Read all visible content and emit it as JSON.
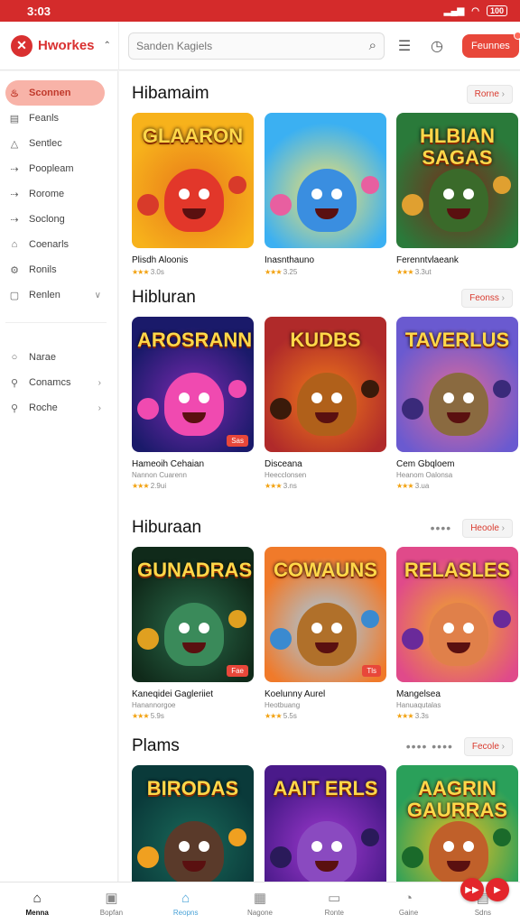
{
  "status_bar": {
    "time": "3:03",
    "battery": "100"
  },
  "header": {
    "brand": "Hworkes",
    "search_placeholder": "Sanden Kagiels",
    "action_button": "Feunnes"
  },
  "sidebar": {
    "primary": [
      {
        "label": "Sconnen",
        "icon": "flame-icon",
        "active": true
      },
      {
        "label": "Feanls",
        "icon": "document-icon"
      },
      {
        "label": "Sentlec",
        "icon": "triangle-icon"
      },
      {
        "label": "Poopleam",
        "icon": "arrow-icon"
      },
      {
        "label": "Rorome",
        "icon": "arrow-icon"
      },
      {
        "label": "Soclong",
        "icon": "arrow-icon"
      },
      {
        "label": "Coenarls",
        "icon": "home-icon"
      },
      {
        "label": "Ronils",
        "icon": "gear-icon"
      },
      {
        "label": "Renlen",
        "icon": "square-icon",
        "chevron": "∨"
      }
    ],
    "secondary": [
      {
        "label": "Narae",
        "icon": "circle-icon"
      },
      {
        "label": "Conamcs",
        "icon": "pin-icon",
        "chevron": "›"
      },
      {
        "label": "Roche",
        "icon": "pin-icon",
        "chevron": "›"
      }
    ]
  },
  "sections": [
    {
      "title": "Hibamaim",
      "more": "",
      "button": "Rorne",
      "cards": [
        {
          "art_title": "GLAARON",
          "name": "Plisdh Aloonis",
          "sub": "",
          "rating": "3.0s",
          "tag": ""
        },
        {
          "art_title": "",
          "name": "Inasnthauno",
          "sub": "",
          "rating": "3.25",
          "tag": ""
        },
        {
          "art_title": "HLBIAN SAGAS",
          "name": "Ferenntvlaeank",
          "sub": "",
          "rating": "3.3ut",
          "tag": ""
        }
      ]
    },
    {
      "title": "Hibluran",
      "more": "",
      "button": "Feonss",
      "cards": [
        {
          "art_title": "AROSRANN",
          "name": "Hameoih Cehaian",
          "sub": "Nannon Cuarenn",
          "rating": "2.9ui",
          "tag": "Sas"
        },
        {
          "art_title": "KUDBS",
          "name": "Disceana",
          "sub": "Heecclonsen",
          "rating": "3.ns",
          "tag": ""
        },
        {
          "art_title": "TAVERLUS",
          "name": "Cem Gbqloem",
          "sub": "Heanom Oalonsa",
          "rating": "3.ua",
          "tag": ""
        }
      ]
    },
    {
      "title": "Hiburaan",
      "more": "••••",
      "button": "Heoole",
      "cards": [
        {
          "art_title": "GUNADRAS",
          "name": "Kaneqidei Gagleriiet",
          "sub": "Hanannorgoe",
          "rating": "5.9s",
          "tag": "Fae"
        },
        {
          "art_title": "COWAUNS",
          "name": "Koelunny Aurel",
          "sub": "Heotbuang",
          "rating": "5.5s",
          "tag": "Tls"
        },
        {
          "art_title": "RELASLES",
          "name": "Mangelsea",
          "sub": "Hanuaqutalas",
          "rating": "3.3s",
          "tag": ""
        }
      ]
    },
    {
      "title": "Plams",
      "more": "•••• ••••",
      "button": "Fecole",
      "cards": [
        {
          "art_title": "BIRODAS",
          "name": "",
          "sub": "",
          "rating": "",
          "tag": ""
        },
        {
          "art_title": "AAIT ERLS",
          "name": "",
          "sub": "",
          "rating": "",
          "tag": ""
        },
        {
          "art_title": "AAGRIN GAURRAS",
          "name": "",
          "sub": "",
          "rating": "",
          "tag": ""
        }
      ]
    }
  ],
  "bottom_nav": [
    {
      "label": "Menna",
      "icon": "home-icon",
      "state": "active"
    },
    {
      "label": "Bopfan",
      "icon": "box-icon",
      "state": ""
    },
    {
      "label": "Reopns",
      "icon": "store-icon",
      "state": "hl"
    },
    {
      "label": "Nagone",
      "icon": "grid-icon",
      "state": ""
    },
    {
      "label": "Ronte",
      "icon": "calendar-icon",
      "state": ""
    },
    {
      "label": "Gaine",
      "icon": "clock-icon",
      "state": ""
    },
    {
      "label": "Sdns",
      "icon": "bag-icon",
      "state": ""
    }
  ],
  "colors": {
    "brand": "#d93030",
    "accent": "#e8473a",
    "sidebar_active": "#f8b3a8"
  }
}
